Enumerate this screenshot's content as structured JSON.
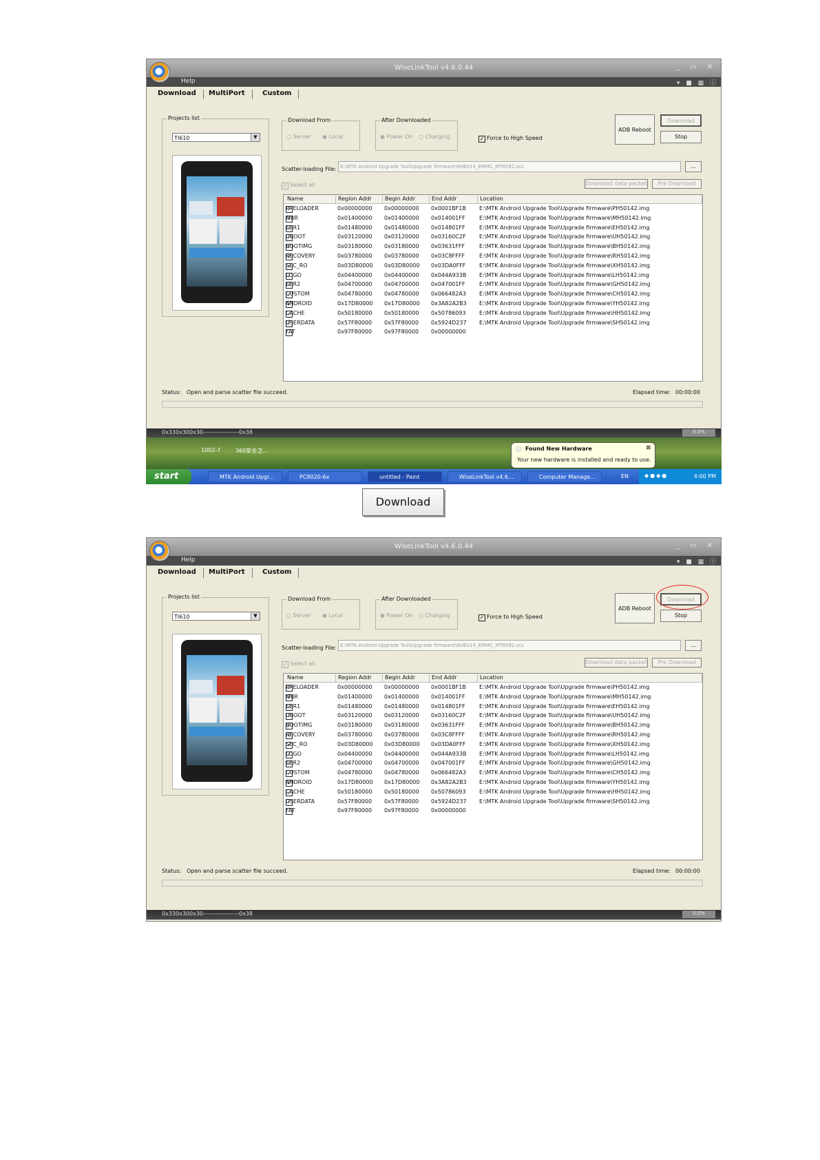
{
  "window": {
    "title": "WiseLinkTool v4.6.0.44",
    "menu_help": "Help",
    "tabs": [
      "Download",
      "MultiPort",
      "Custom"
    ],
    "projects_label": "Projects list",
    "project_value": "TI610",
    "download_from_label": "Download From",
    "download_from_options": [
      "Server",
      "Local"
    ],
    "after_downloaded_label": "After Downloaded",
    "after_downloaded_options": [
      "Power On",
      "Charging"
    ],
    "force_high_speed": "Force to High Speed",
    "adb_reboot": "ADB Reboot",
    "download_btn": "Download",
    "stop_btn": "Stop",
    "scatter_label": "Scatter-loading File:",
    "scatter_value": "E:\\MTK Android Upgrade Tool\\Upgrade firmware\\KH6014_EMMC_MT6582.scs",
    "browse_btn": "...",
    "select_all": "Select all",
    "download_data_packet": "Download data packet",
    "pre_download": "Pre Download",
    "status_label": "Status:",
    "status_text": "Open and parse scatter file succeed.",
    "elapsed_label": "Elapsed time:",
    "elapsed_value": "00:00:00",
    "bottom_text": "0x330x300x30------------------0x38",
    "progress_pct": "0.0%"
  },
  "table": {
    "headers": [
      "Name",
      "Region Addr",
      "Begin Addr",
      "End Addr",
      "Location"
    ],
    "rows": [
      {
        "checked": true,
        "name": "PRELOADER",
        "region": "0x00000000",
        "begin": "0x00000000",
        "end": "0x0001BF1B",
        "loc": "E:\\MTK Android Upgrade Tool\\Upgrade firmware\\PH50142.img"
      },
      {
        "checked": true,
        "name": "MBR",
        "region": "0x01400000",
        "begin": "0x01400000",
        "end": "0x014001FF",
        "loc": "E:\\MTK Android Upgrade Tool\\Upgrade firmware\\MH50142.img"
      },
      {
        "checked": true,
        "name": "EBR1",
        "region": "0x01480000",
        "begin": "0x01480000",
        "end": "0x014801FF",
        "loc": "E:\\MTK Android Upgrade Tool\\Upgrade firmware\\EH50142.img"
      },
      {
        "checked": true,
        "name": "UBOOT",
        "region": "0x03120000",
        "begin": "0x03120000",
        "end": "0x03160C2F",
        "loc": "E:\\MTK Android Upgrade Tool\\Upgrade firmware\\UH50142.img"
      },
      {
        "checked": true,
        "name": "BOOTIMG",
        "region": "0x03180000",
        "begin": "0x03180000",
        "end": "0x03631FFF",
        "loc": "E:\\MTK Android Upgrade Tool\\Upgrade firmware\\BH50142.img"
      },
      {
        "checked": true,
        "name": "RECOVERY",
        "region": "0x03780000",
        "begin": "0x03780000",
        "end": "0x03C8FFFF",
        "loc": "E:\\MTK Android Upgrade Tool\\Upgrade firmware\\RH50142.img"
      },
      {
        "checked": true,
        "name": "SEC_RO",
        "region": "0x03D80000",
        "begin": "0x03D80000",
        "end": "0x03DA0FFF",
        "loc": "E:\\MTK Android Upgrade Tool\\Upgrade firmware\\XH50142.img"
      },
      {
        "checked": true,
        "name": "LOGO",
        "region": "0x04400000",
        "begin": "0x04400000",
        "end": "0x044A933B",
        "loc": "E:\\MTK Android Upgrade Tool\\Upgrade firmware\\LH50142.img"
      },
      {
        "checked": true,
        "name": "EBR2",
        "region": "0x04700000",
        "begin": "0x04700000",
        "end": "0x047001FF",
        "loc": "E:\\MTK Android Upgrade Tool\\Upgrade firmware\\GH50142.img"
      },
      {
        "checked": true,
        "name": "CUSTOM",
        "region": "0x04780000",
        "begin": "0x04780000",
        "end": "0x066482A3",
        "loc": "E:\\MTK Android Upgrade Tool\\Upgrade firmware\\CH50142.img"
      },
      {
        "checked": true,
        "name": "ANDROID",
        "region": "0x17D80000",
        "begin": "0x17D80000",
        "end": "0x3A82A2B3",
        "loc": "E:\\MTK Android Upgrade Tool\\Upgrade firmware\\YH50142.img"
      },
      {
        "checked": true,
        "name": "CACHE",
        "region": "0x50180000",
        "begin": "0x50180000",
        "end": "0x50786093",
        "loc": "E:\\MTK Android Upgrade Tool\\Upgrade firmware\\HH50142.img"
      },
      {
        "checked": true,
        "name": "USERDATA",
        "region": "0x57F80000",
        "begin": "0x57F80000",
        "end": "0x5924D237",
        "loc": "E:\\MTK Android Upgrade Tool\\Upgrade firmware\\SH50142.img"
      },
      {
        "checked": false,
        "name": "FAT",
        "region": "0x97F80000",
        "begin": "0x97F80000",
        "end": "0x00000000",
        "loc": ""
      }
    ]
  },
  "taskbar": {
    "start": "start",
    "items": [
      "MTK Android Upgr...",
      "PC8020-6x",
      "untitled - Paint",
      "WiseLinkTool v4.6....",
      "Computer Manage..."
    ],
    "lang": "EN",
    "clock": "4:00 PM"
  },
  "desktop_icons": [
    "1002-7",
    "360安全卫..."
  ],
  "balloon": {
    "title": "Found New Hardware",
    "text": "Your new hardware is installed and ready to use."
  },
  "callout_button": "Download",
  "colors": {
    "window_bg": "#ece9d8",
    "taskbar": "#2556c4",
    "highlight_circle": "#e02020"
  }
}
